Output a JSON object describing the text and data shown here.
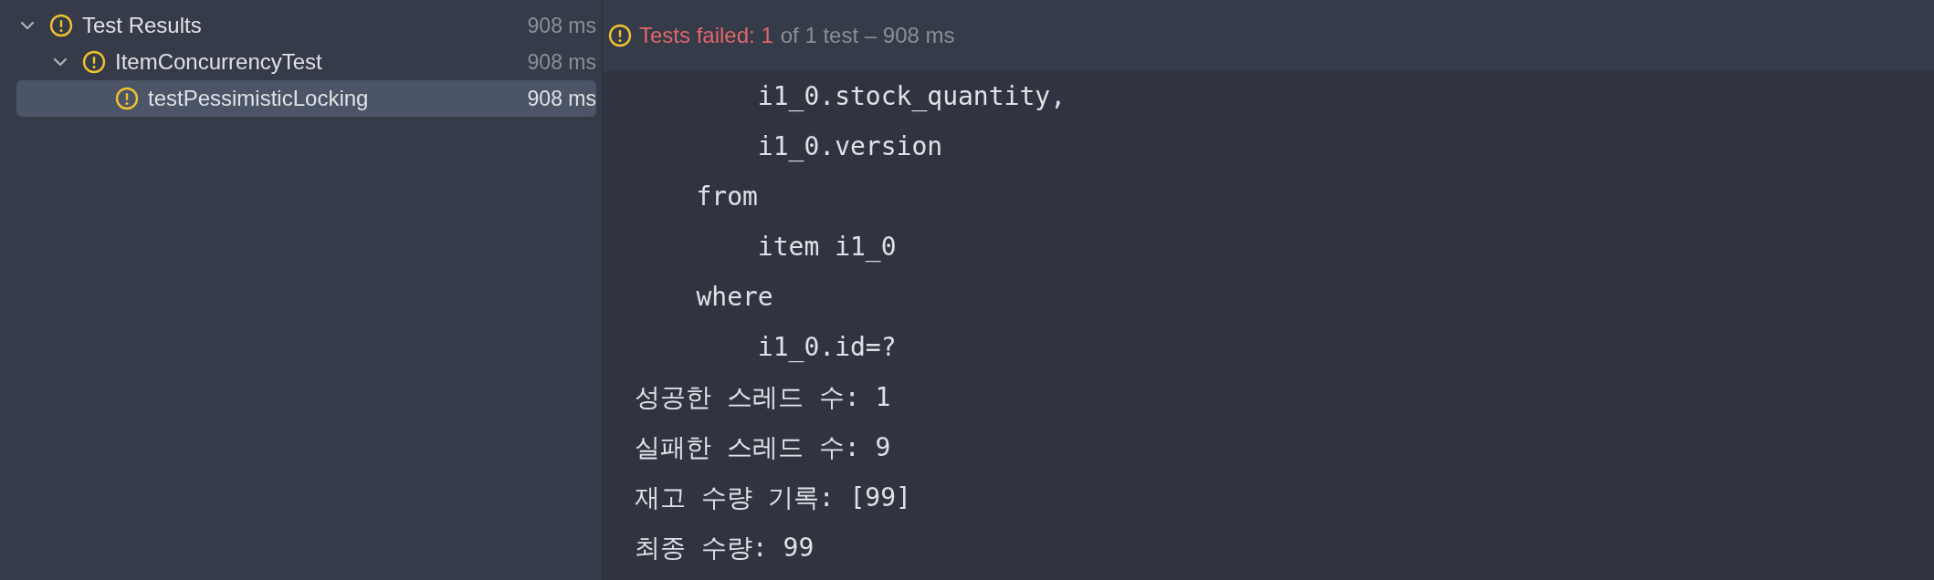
{
  "tree": [
    {
      "label": "Test Results",
      "time": "908 ms",
      "kind": "warning",
      "expanded": true,
      "selected": false,
      "children": [
        {
          "label": "ItemConcurrencyTest",
          "time": "908 ms",
          "kind": "warning",
          "expanded": true,
          "selected": false,
          "children": [
            {
              "label": "testPessimisticLocking",
              "time": "908 ms",
              "kind": "warning",
              "selected": true
            }
          ]
        }
      ]
    }
  ],
  "header": {
    "kind": "warning",
    "failed": "Tests failed: 1",
    "summary": "of 1 test – 908 ms"
  },
  "console_lines": [
    "        i1_0.stock_quantity,",
    "        i1_0.version",
    "    from",
    "        item i1_0",
    "    where",
    "        i1_0.id=?",
    "성공한 스레드 수: 1",
    "실패한 스레드 수: 9",
    "재고 수량 기록: [99]",
    "최종 수량: 99"
  ]
}
